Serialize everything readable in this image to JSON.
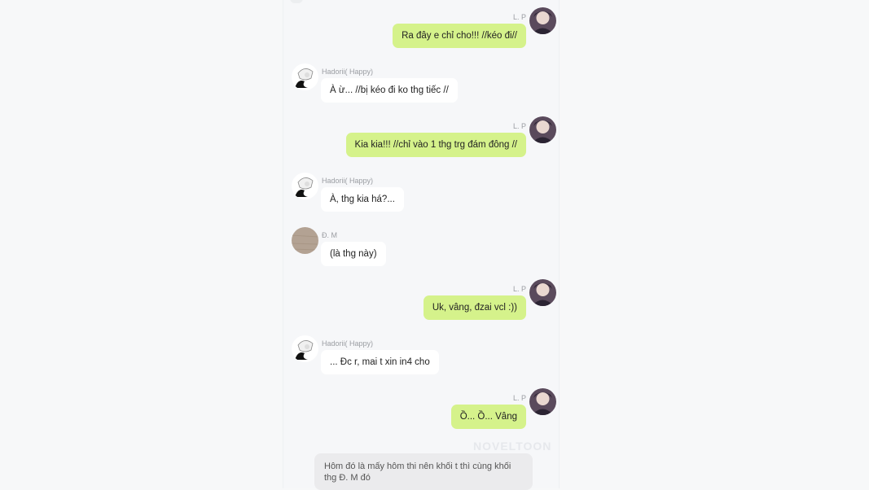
{
  "messages": [
    {
      "sender": "L. P",
      "text": "Ra đây e chỉ cho!!! //kéo đi//"
    },
    {
      "sender": "Hadorii( Happy)",
      "text": "À ừ... //bị kéo đi ko thg tiếc //"
    },
    {
      "sender": "L. P",
      "text": "Kia kia!!! //chỉ vào 1 thg trg đám đông //"
    },
    {
      "sender": "Hadorii( Happy)",
      "text": "À, thg kia há?..."
    },
    {
      "sender": "Đ. M",
      "text": "(là thg này)"
    },
    {
      "sender": "L. P",
      "text": "Uk, vâng, đzai vcl :))"
    },
    {
      "sender": "Hadorii( Happy)",
      "text": "... Đc r, mai t xin in4 cho"
    },
    {
      "sender": "L. P",
      "text": "Ồ... Ồ... Vâng"
    }
  ],
  "narration": "Hôm đó là mấy hôm thi nên khối t thì cùng khối thg Đ. M đó",
  "watermark": "NOVELTOON",
  "colors": {
    "outgoing_bubble": "#d5f28b",
    "incoming_bubble": "#ffffff",
    "narration_bg": "#ebebed",
    "background": "#f6f7f9"
  }
}
